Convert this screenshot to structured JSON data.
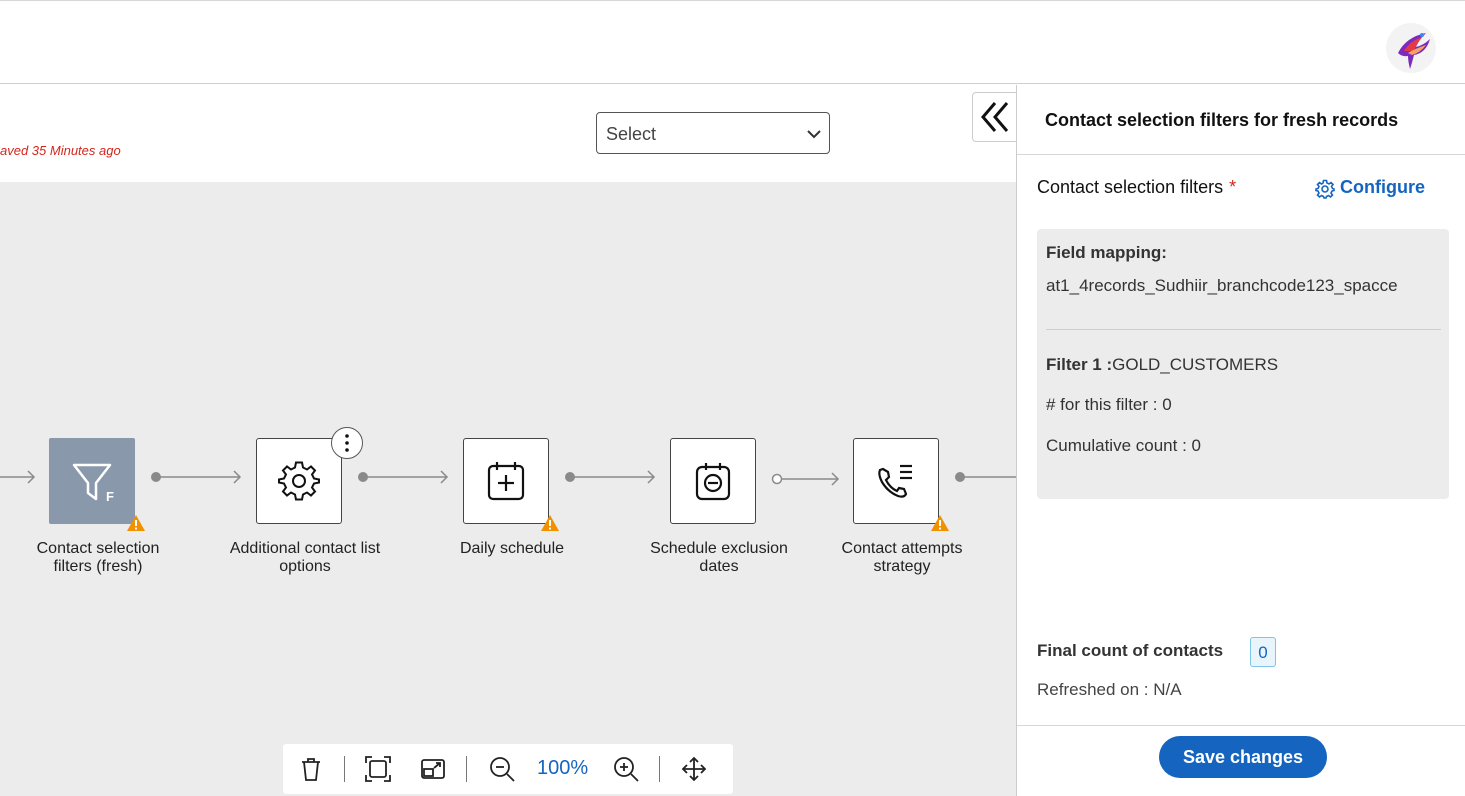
{
  "header": {
    "saved_status": "aved 35 Minutes ago",
    "select": {
      "value": "Select"
    }
  },
  "flow": {
    "nodes": [
      {
        "label": "Contact selection filters (fresh)",
        "icon": "filter-icon",
        "warning": true,
        "active": true
      },
      {
        "label": "Additional contact list options",
        "icon": "gear-icon",
        "warning": false,
        "active": false
      },
      {
        "label": "Daily schedule",
        "icon": "calendar-plus-icon",
        "warning": true,
        "active": false
      },
      {
        "label": "Schedule exclusion dates",
        "icon": "calendar-minus-icon",
        "warning": false,
        "active": false
      },
      {
        "label": "Contact attempts strategy",
        "icon": "phone-list-icon",
        "warning": true,
        "active": false
      }
    ],
    "filter_badge": "F"
  },
  "toolbar": {
    "zoom": "100%",
    "icons": [
      "trash-icon",
      "fit-screen-icon",
      "resize-icon",
      "zoom-out-icon",
      "zoom-in-icon",
      "move-icon"
    ]
  },
  "panel": {
    "title": "Contact selection filters for fresh records",
    "csf_label": "Contact selection filters",
    "required_mark": "*",
    "configure_label": "Configure",
    "field_mapping_label": "Field mapping:",
    "field_mapping_value": "at1_4records_Sudhiir_branchcode123_spacce",
    "filter_label": "Filter 1 :",
    "filter_value": "GOLD_CUSTOMERS",
    "filter_count": "# for this filter : 0",
    "cumulative_count": "Cumulative count : 0",
    "final_count_label": "Final count of contacts",
    "final_count_value": "0",
    "refreshed": "Refreshed on : N/A",
    "save_label": "Save changes"
  },
  "colors": {
    "accent": "#1565c0",
    "warning": "#f29100",
    "error": "#d4261c",
    "active_node": "#8a98ab",
    "canvas": "#ececec"
  }
}
